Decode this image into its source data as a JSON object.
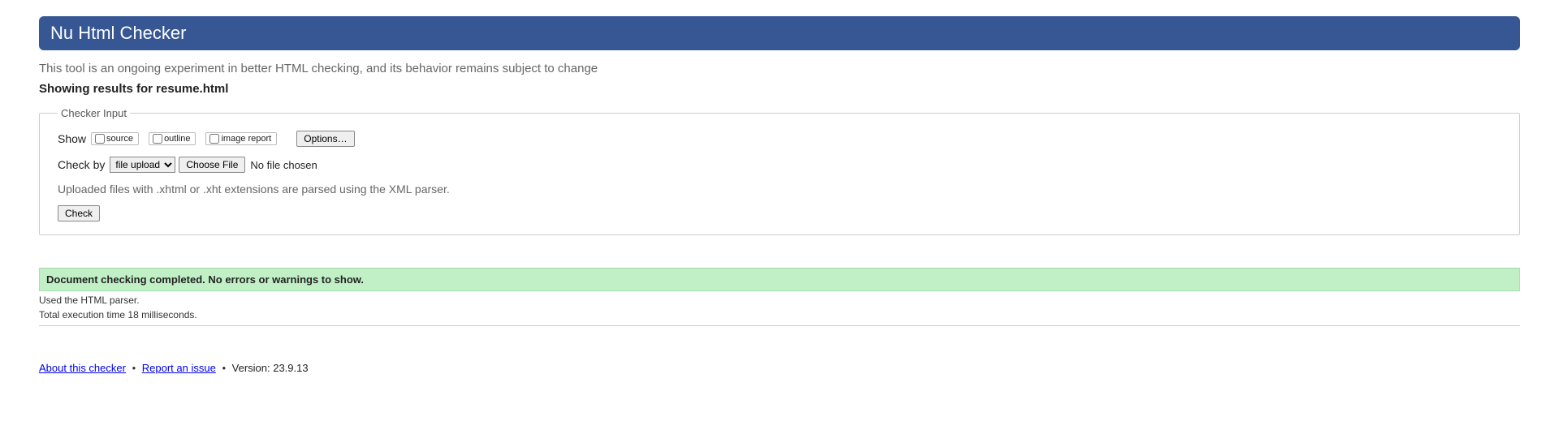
{
  "header": {
    "title": "Nu Html Checker"
  },
  "subtitle": "This tool is an ongoing experiment in better HTML checking, and its behavior remains subject to change",
  "results_for": "Showing results for resume.html",
  "checker_input": {
    "legend": "Checker Input",
    "show_label": "Show",
    "cb_source": "source",
    "cb_outline": "outline",
    "cb_image_report": "image report",
    "options_btn": "Options…",
    "check_by_label": "Check by",
    "select_value": "file upload",
    "choose_file_btn": "Choose File",
    "no_file_text": "No file chosen",
    "xml_note": "Uploaded files with .xhtml or .xht extensions are parsed using the XML parser.",
    "check_btn": "Check"
  },
  "success_msg": "Document checking completed. No errors or warnings to show.",
  "parser_line": "Used the HTML parser.",
  "exec_line": "Total execution time 18 milliseconds.",
  "footer": {
    "about": "About this checker",
    "report": "Report an issue",
    "version": "Version: 23.9.13"
  }
}
